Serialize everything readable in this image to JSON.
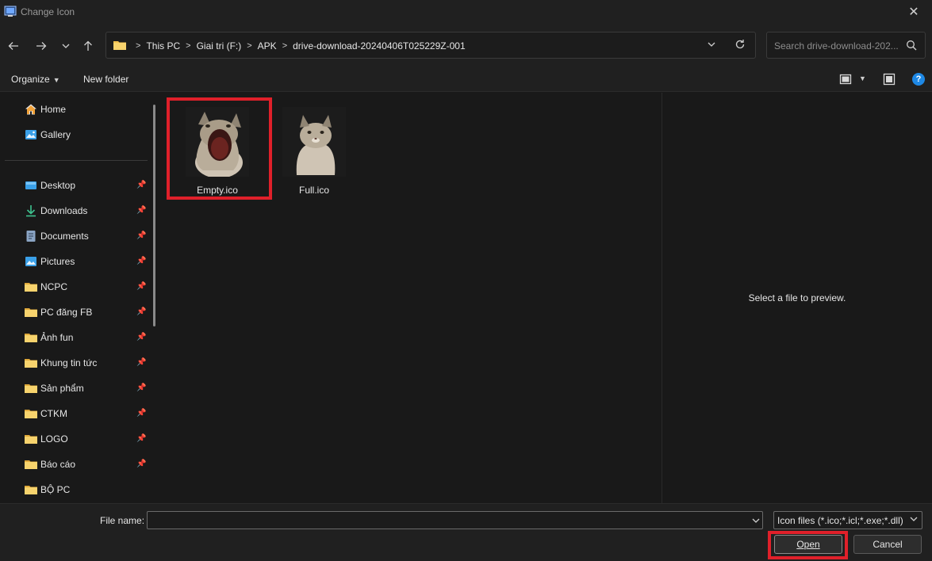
{
  "window": {
    "title": "Change Icon",
    "close_glyph": "✕"
  },
  "nav": {
    "back_icon": "arrow-left-icon",
    "forward_icon": "arrow-right-icon",
    "recent_icon": "chevron-down-icon",
    "up_icon": "arrow-up-icon",
    "breadcrumbs": [
      "This PC",
      "Giai tri (F:)",
      "APK",
      "drive-download-20240406T025229Z-001"
    ],
    "search_placeholder": "Search drive-download-202..."
  },
  "toolbar": {
    "organize_label": "Organize",
    "new_folder_label": "New folder",
    "help_label": "?"
  },
  "sidebar": {
    "quick": [
      {
        "label": "Home",
        "icon": "home-icon"
      },
      {
        "label": "Gallery",
        "icon": "gallery-icon"
      }
    ],
    "pinned": [
      {
        "label": "Desktop",
        "icon": "desktop-icon"
      },
      {
        "label": "Downloads",
        "icon": "download-icon"
      },
      {
        "label": "Documents",
        "icon": "documents-icon"
      },
      {
        "label": "Pictures",
        "icon": "pictures-icon"
      },
      {
        "label": "NCPC",
        "icon": "folder-icon"
      },
      {
        "label": "PC đăng FB",
        "icon": "folder-icon"
      },
      {
        "label": "Ảnh fun",
        "icon": "folder-icon"
      },
      {
        "label": "Khung tin tức",
        "icon": "folder-icon"
      },
      {
        "label": "Sản phẩm",
        "icon": "folder-icon"
      },
      {
        "label": "CTKM",
        "icon": "folder-icon"
      },
      {
        "label": "LOGO",
        "icon": "folder-icon"
      },
      {
        "label": "Báo cáo",
        "icon": "folder-icon"
      },
      {
        "label": "BỘ PC",
        "icon": "folder-icon"
      }
    ]
  },
  "files": [
    {
      "name": "Empty.ico",
      "thumb": "cat-mouth-open-icon"
    },
    {
      "name": "Full.ico",
      "thumb": "cat-mouth-closed-icon"
    }
  ],
  "preview": {
    "message": "Select a file to preview."
  },
  "bottom": {
    "file_name_label": "File name:",
    "file_name_value": "",
    "filter_value": "Icon files (*.ico;*.icl;*.exe;*.dll)",
    "open_label": "Open",
    "cancel_label": "Cancel"
  },
  "colors": {
    "highlight": "#e0202a",
    "folder": "#f2c14e",
    "accent": "#1e88e5"
  }
}
